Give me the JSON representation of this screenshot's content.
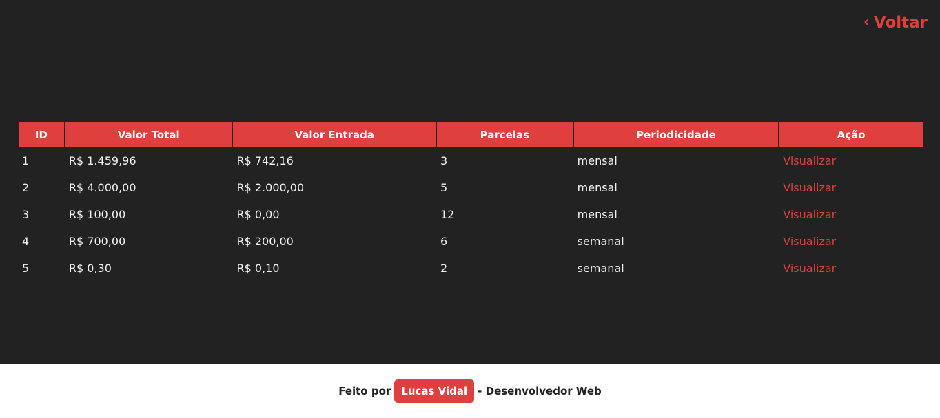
{
  "header": {
    "back_label": "Voltar",
    "back_icon": "chevron-left-icon"
  },
  "table": {
    "columns": [
      "ID",
      "Valor Total",
      "Valor Entrada",
      "Parcelas",
      "Periodicidade",
      "Ação"
    ],
    "rows": [
      {
        "id": "1",
        "valor_total": "R$ 1.459,96",
        "valor_entrada": "R$ 742,16",
        "parcelas": "3",
        "periodicidade": "mensal",
        "acao": "Visualizar"
      },
      {
        "id": "2",
        "valor_total": "R$ 4.000,00",
        "valor_entrada": "R$ 2.000,00",
        "parcelas": "5",
        "periodicidade": "mensal",
        "acao": "Visualizar"
      },
      {
        "id": "3",
        "valor_total": "R$ 100,00",
        "valor_entrada": "R$ 0,00",
        "parcelas": "12",
        "periodicidade": "mensal",
        "acao": "Visualizar"
      },
      {
        "id": "4",
        "valor_total": "R$ 700,00",
        "valor_entrada": "R$ 200,00",
        "parcelas": "6",
        "periodicidade": "semanal",
        "acao": "Visualizar"
      },
      {
        "id": "5",
        "valor_total": "R$ 0,30",
        "valor_entrada": "R$ 0,10",
        "parcelas": "2",
        "periodicidade": "semanal",
        "acao": "Visualizar"
      }
    ]
  },
  "footer": {
    "prefix": "Feito por",
    "author": "Lucas Vidal",
    "suffix": "- Desenvolvedor Web"
  },
  "colors": {
    "background": "#232222",
    "accent": "#df3f3d",
    "footer_background": "#ffffff"
  }
}
